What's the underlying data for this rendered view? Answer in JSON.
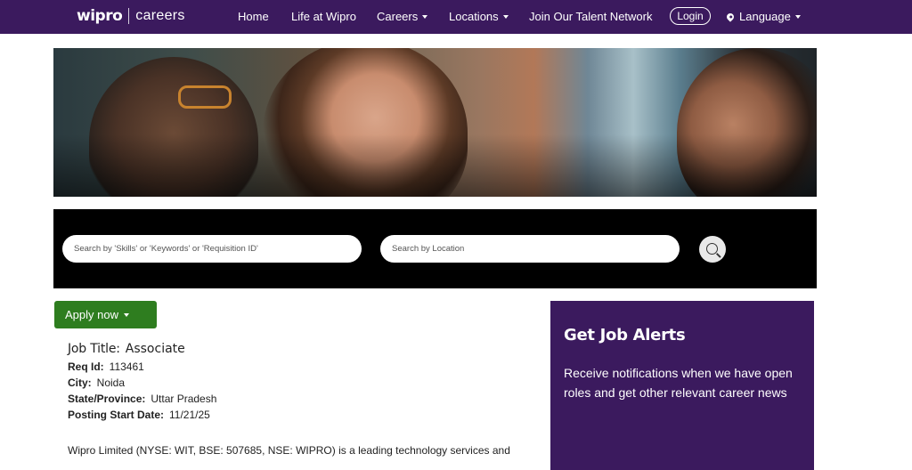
{
  "header": {
    "logo_brand": "wipro",
    "logo_section": "careers",
    "nav": [
      {
        "label": "Home"
      },
      {
        "label": "Life at Wipro"
      },
      {
        "label": "Careers"
      },
      {
        "label": "Locations"
      },
      {
        "label": "Join Our Talent Network"
      }
    ],
    "login_label": "Login",
    "language_label": "Language",
    "colors": {
      "nav_bg": "#3b1a5e"
    }
  },
  "hero": {
    "image": "photo of smiling colleagues"
  },
  "search": {
    "keywords_placeholder": "Search by 'Skills' or 'Keywords' or 'Requisition ID'",
    "location_placeholder": "Search by Location",
    "search_icon": "search-icon"
  },
  "apply": {
    "label": "Apply now",
    "color": "#2e7d1f"
  },
  "job": {
    "title_label": "Job Title:",
    "title_value": "Associate",
    "req_label": "Req Id:",
    "req_value": "113461",
    "city_label": "City:",
    "city_value": "Noida",
    "state_label": "State/Province:",
    "state_value": "Uttar Pradesh",
    "date_label": "Posting Start Date:",
    "date_value": "11/21/25",
    "description": "Wipro Limited (NYSE: WIT, BSE: 507685, NSE: WIPRO) is a leading technology services and"
  },
  "alerts": {
    "title": "Get Job Alerts",
    "text": "Receive notifications when we have open roles and get other relevant career news"
  }
}
